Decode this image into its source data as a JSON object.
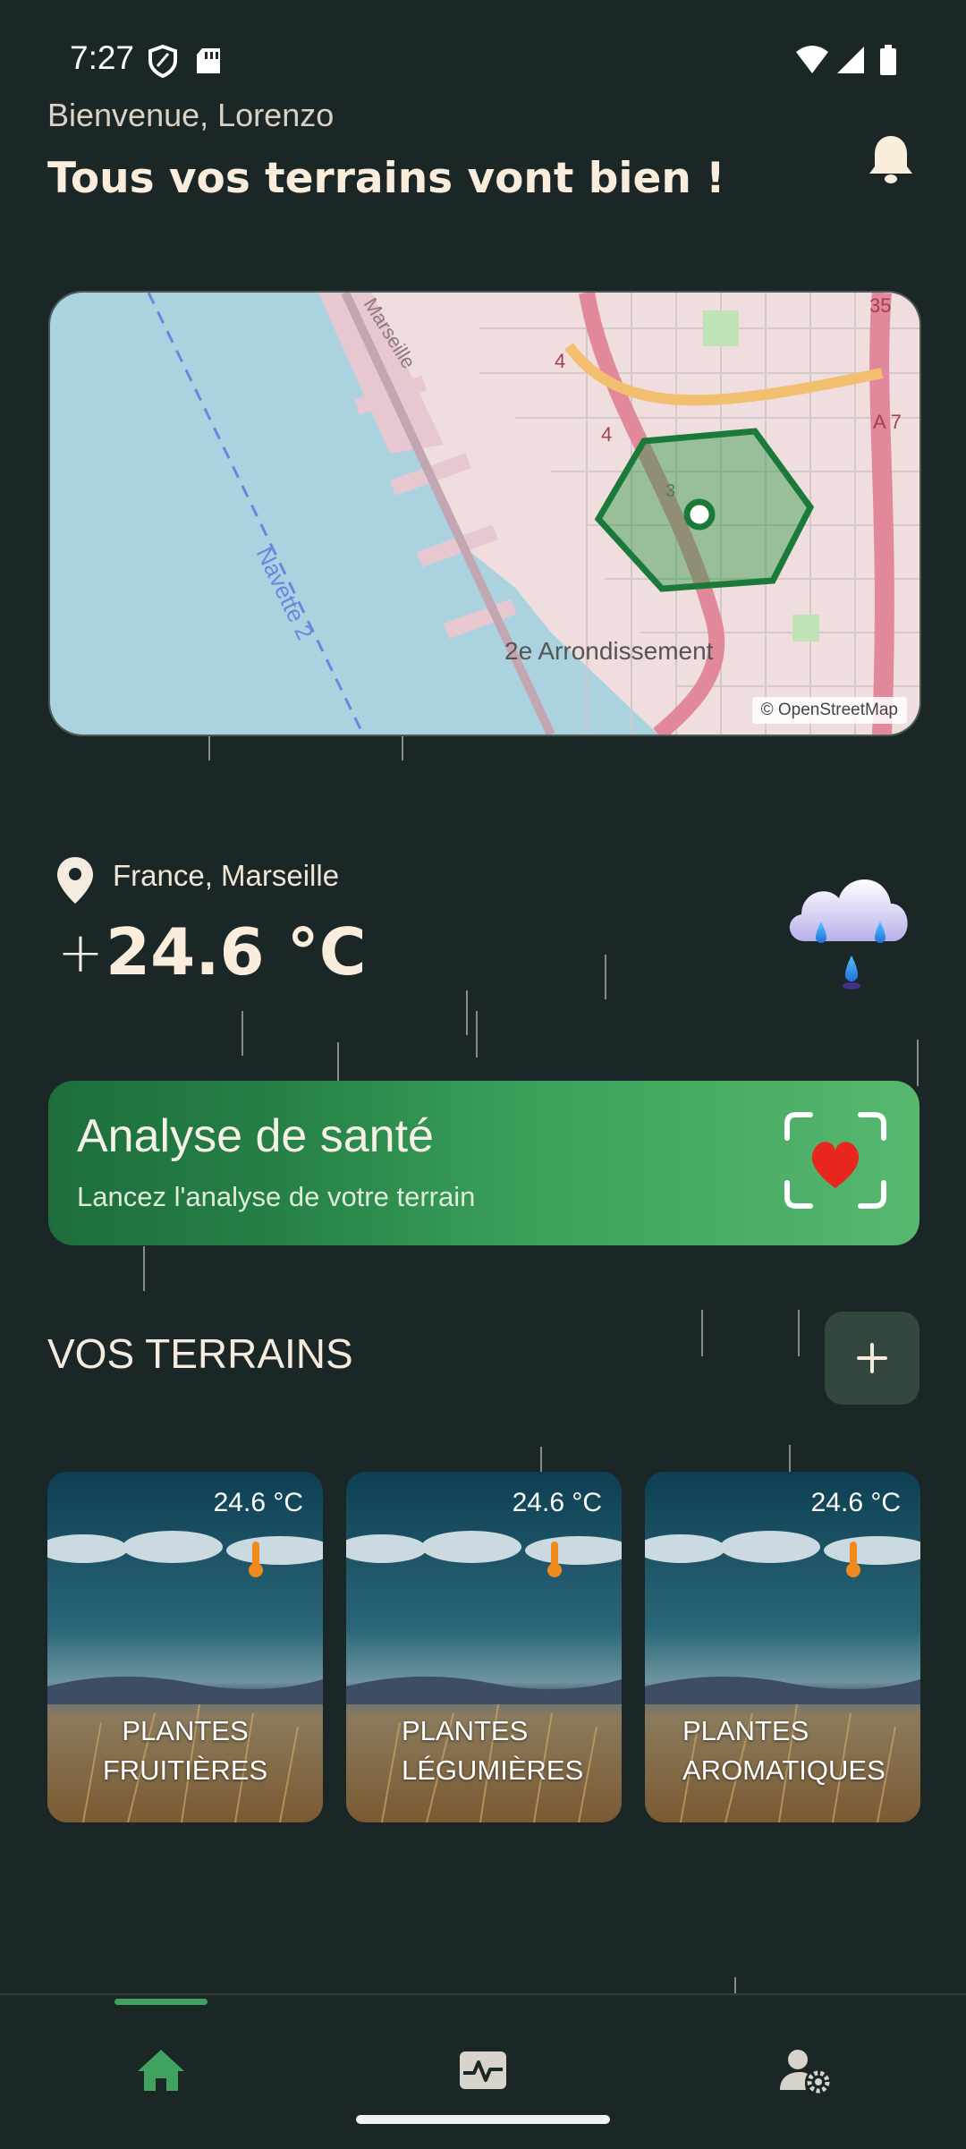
{
  "status_bar": {
    "time": "7:27"
  },
  "header": {
    "greeting": "Bienvenue, Lorenzo",
    "headline": "Tous vos terrains vont bien !"
  },
  "map": {
    "attribution": "© OpenStreetMap",
    "labels": {
      "district": "2e Arrondissement",
      "ferry": "Navette 2",
      "street": "Marseille",
      "road_a7": "A 7",
      "road_35": "35",
      "route_4": "4",
      "route_3": "3"
    }
  },
  "weather": {
    "location": "France, Marseille",
    "sign": "+",
    "temperature": "24.6 °C",
    "icon": "rain-cloud-icon"
  },
  "health_card": {
    "title": "Analyse de santé",
    "subtitle": "Lancez l'analyse de votre terrain",
    "icon": "heart-scan-icon"
  },
  "terrains": {
    "section_title": "VOS TERRAINS",
    "add_label": "+",
    "cards": [
      {
        "temperature": "24.6 °C",
        "label_line1": "PLANTES FRUITIÈRES",
        "label_line2": ""
      },
      {
        "temperature": "24.6 °C",
        "label_line1": "PLANTES",
        "label_line2": "LÉGUMIÈRES"
      },
      {
        "temperature": "24.6 °C",
        "label_line1": "PLANTES",
        "label_line2": "AROMATIQUES"
      }
    ]
  },
  "nav": {
    "items": [
      {
        "icon": "home-icon",
        "active": true
      },
      {
        "icon": "health-monitor-icon",
        "active": false
      },
      {
        "icon": "user-settings-icon",
        "active": false
      }
    ],
    "accent": "#3fa35f"
  }
}
